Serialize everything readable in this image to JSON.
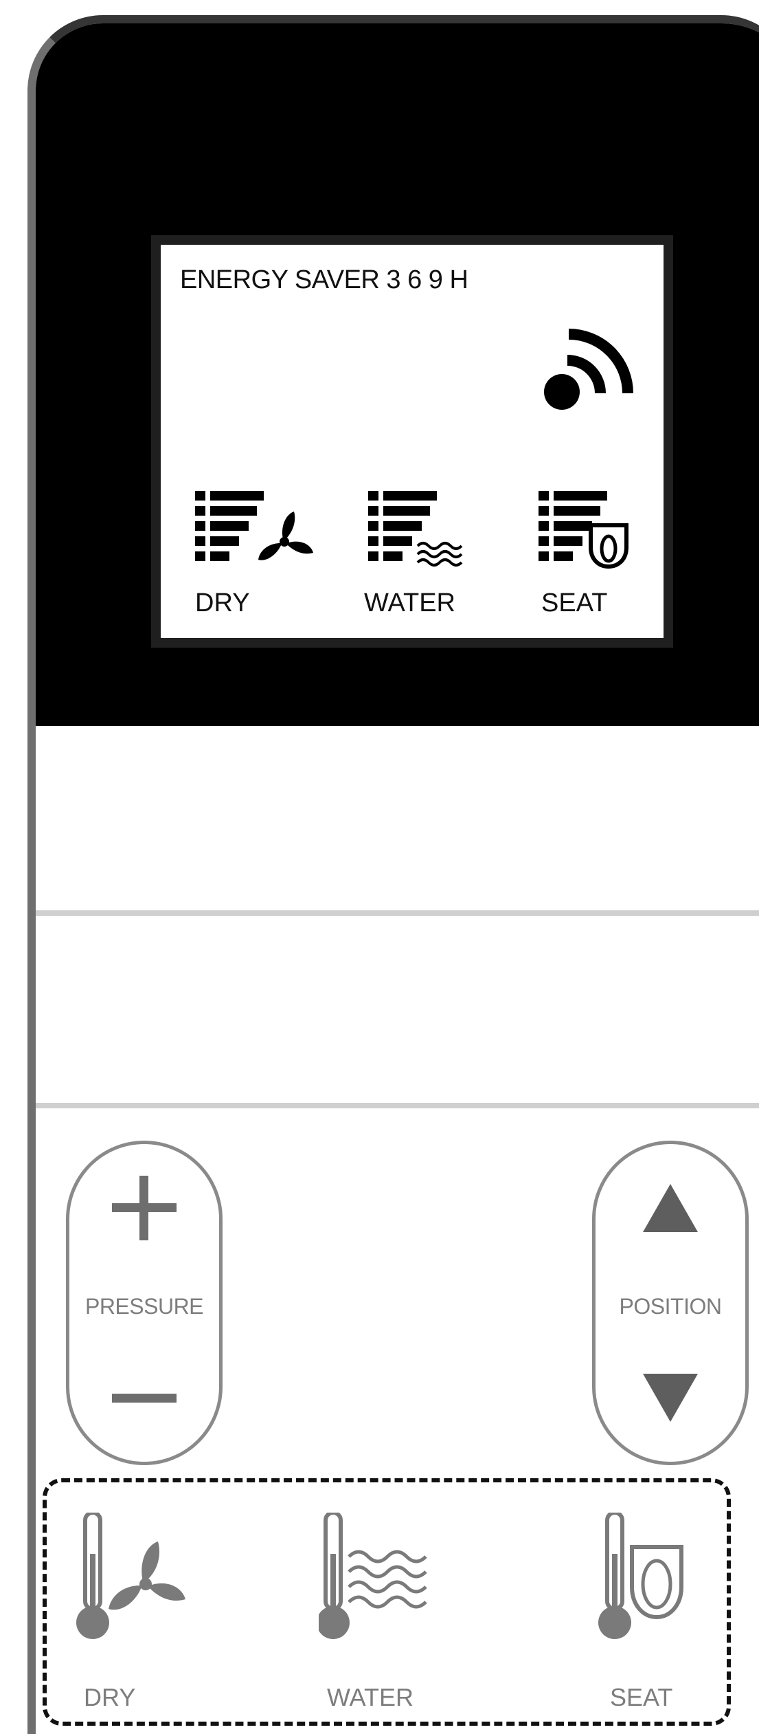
{
  "display": {
    "energy_saver_text": "ENERGY SAVER  3  6  9  H",
    "dry_label": "DRY",
    "water_label": "WATER",
    "seat_label": "SEAT"
  },
  "controls": {
    "pressure_label": "PRESSURE",
    "position_label": "POSITION"
  },
  "temperature": {
    "dry_label": "DRY",
    "water_label": "WATER",
    "seat_label": "SEAT"
  },
  "colors": {
    "panel_black": "#000000",
    "button_gray": "#8a8a8a",
    "label_gray": "#7d7d7d",
    "icon_gray": "#7a7a7a"
  },
  "icons": {
    "signal": "signal-icon",
    "fan": "fan-icon",
    "waves": "water-waves-icon",
    "seat": "seat-icon",
    "plus": "plus-icon",
    "minus": "minus-icon",
    "up": "triangle-up-icon",
    "down": "triangle-down-icon",
    "thermometer": "thermometer-icon"
  }
}
